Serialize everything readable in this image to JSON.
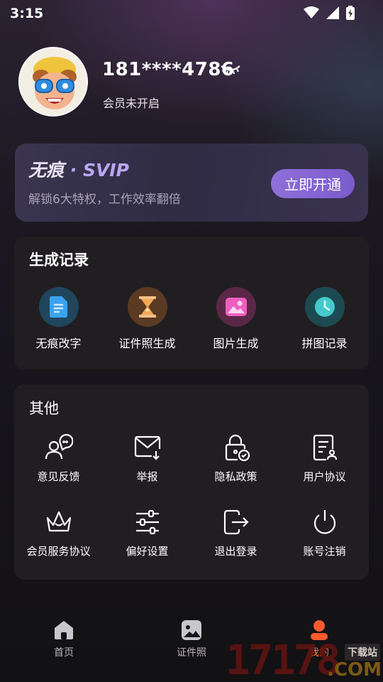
{
  "status_bar": {
    "time": "3:15"
  },
  "profile": {
    "phone": "181****4786",
    "member_status": "会员未开启"
  },
  "vip": {
    "title_main": "无痕",
    "title_dot": "·",
    "title_tier": "SVIP",
    "subtitle": "解锁6大特权，工作效率翻倍",
    "button": "立即开通"
  },
  "records": {
    "title": "生成记录",
    "items": [
      {
        "label": "无痕改字",
        "icon": "document-icon"
      },
      {
        "label": "证件照生成",
        "icon": "hourglass-icon"
      },
      {
        "label": "图片生成",
        "icon": "image-icon"
      },
      {
        "label": "拼图记录",
        "icon": "clock-icon"
      }
    ]
  },
  "other": {
    "title": "其他",
    "items": [
      {
        "label": "意见反馈",
        "icon": "feedback-icon"
      },
      {
        "label": "举报",
        "icon": "report-mail-icon"
      },
      {
        "label": "隐私政策",
        "icon": "privacy-lock-icon"
      },
      {
        "label": "用户协议",
        "icon": "user-agreement-icon"
      },
      {
        "label": "会员服务协议",
        "icon": "crown-icon"
      },
      {
        "label": "偏好设置",
        "icon": "sliders-icon"
      },
      {
        "label": "退出登录",
        "icon": "logout-icon"
      },
      {
        "label": "账号注销",
        "icon": "power-icon"
      }
    ]
  },
  "nav": {
    "items": [
      {
        "label": "首页",
        "icon": "home-icon"
      },
      {
        "label": "证件照",
        "icon": "id-photo-icon"
      },
      {
        "label": "我的",
        "icon": "profile-icon"
      }
    ]
  },
  "watermark": {
    "digits": "17178",
    "suffix": ".COM",
    "download": "下载站"
  },
  "colors": {
    "accent": "#8f6fd8",
    "nav_active": "#ff7a3d",
    "card_bg": "#211e21"
  }
}
